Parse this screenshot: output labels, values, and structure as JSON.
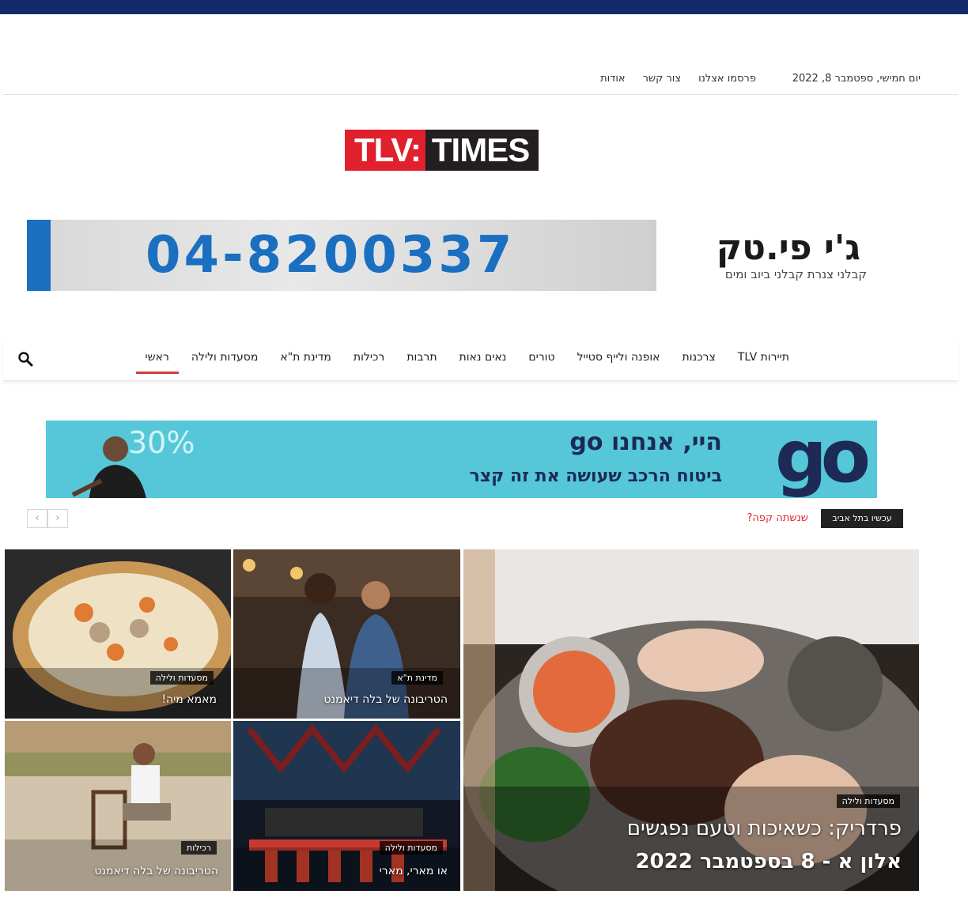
{
  "topbar": {
    "date": "יום חמישי, ספטמבר 8, 2022",
    "links": [
      "אודות",
      "צור קשר",
      "פרסמו אצלנו"
    ]
  },
  "logo": {
    "left": "TLV:",
    "right": "TIMES"
  },
  "ad_banner_1": {
    "phone": "04-8200337",
    "brand": "ג'י פי.טק",
    "subtitle": "קבלני צנרת   קבלני ביוב ומים"
  },
  "nav": {
    "items": [
      "ראשי",
      "מסעדות ולילה",
      "מדינת ת\"א",
      "רכילות",
      "תרבות",
      "נאים נאות",
      "טורים",
      "אופנה ולייף סטייל",
      "צרכנות",
      "תיירות TLV"
    ],
    "active_index": 0,
    "search_icon": "search-icon"
  },
  "ad_banner_2": {
    "logo": "go",
    "line1": "היי, אנחנו go",
    "line2": "ביטוח הרכב שעושה את זה קצר",
    "percent": "30%"
  },
  "ticker": {
    "label": "עכשיו בתל אביב",
    "headline": "שנשתה קפה?",
    "prev": "‹",
    "next": "›"
  },
  "articles": {
    "featured": {
      "category": "מסעדות ולילה",
      "title_line1": "פרדריק: כשאיכות וטעם נפגשים",
      "title_line2": "אלון א - 8 בספטמבר 2022"
    },
    "a1": {
      "category": "מסעדות ולילה",
      "title": "מאמא מיה!"
    },
    "a2": {
      "category": "מדינת ת\"א",
      "title": "הטריבונה של בלה דיאמנט"
    },
    "a3": {
      "category": "רכילות",
      "title": "הטריבונה של בלה דיאמנט"
    },
    "a4": {
      "category": "מסעדות ולילה",
      "title": "או מארי, מארי"
    }
  },
  "colors": {
    "stripe": "#142a6b",
    "accent_red": "#e0202d",
    "go_teal": "#55c7d8",
    "phone_blue": "#1a6fc0"
  }
}
